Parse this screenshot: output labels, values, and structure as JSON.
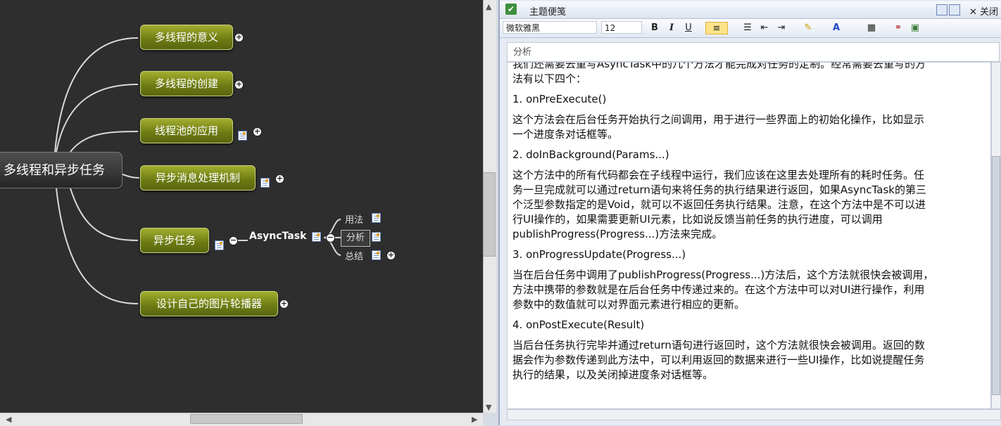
{
  "mindmap": {
    "root": "多线程和异步任务",
    "topics": [
      "多线程的意义",
      "多线程的创建",
      "线程池的应用",
      "异步消息处理机制",
      "异步任务",
      "设计自己的图片轮播器"
    ],
    "asynctask": "AsyncTask",
    "subs": {
      "usage": "用法",
      "analysis": "分析",
      "summary": "总结"
    }
  },
  "panel": {
    "title": "主题便笺",
    "close": "关闭",
    "font": "微软雅黑",
    "size": "12",
    "subject_placeholder": "分析",
    "lines": [
      "我们还需要去重写AsyncTask中的几个方法才能完成对任务的定制。经常需要去重写的方",
      "法有以下四个：",
      "1. onPreExecute()",
      "这个方法会在后台任务开始执行之间调用，用于进行一些界面上的初始化操作，比如显示",
      "一个进度条对话框等。",
      "2. doInBackground(Params...)",
      "这个方法中的所有代码都会在子线程中运行，我们应该在这里去处理所有的耗时任务。任",
      "务一旦完成就可以通过return语句来将任务的执行结果进行返回，如果AsyncTask的第三",
      "个泛型参数指定的是Void，就可以不返回任务执行结果。注意，在这个方法中是不可以进",
      "行UI操作的，如果需要更新UI元素，比如说反馈当前任务的执行进度，可以调用",
      "publishProgress(Progress...)方法来完成。",
      "3. onProgressUpdate(Progress...)",
      "当在后台任务中调用了publishProgress(Progress...)方法后，这个方法就很快会被调用，",
      "方法中携带的参数就是在后台任务中传递过来的。在这个方法中可以对UI进行操作，利用",
      "参数中的数值就可以对界面元素进行相应的更新。",
      "4. onPostExecute(Result)",
      "当后台任务执行完毕并通过return语句进行返回时，这个方法就很快会被调用。返回的数",
      "据会作为参数传递到此方法中，可以利用返回的数据来进行一些UI操作，比如说提醒任务",
      "执行的结果，以及关闭掉进度条对话框等。"
    ]
  }
}
